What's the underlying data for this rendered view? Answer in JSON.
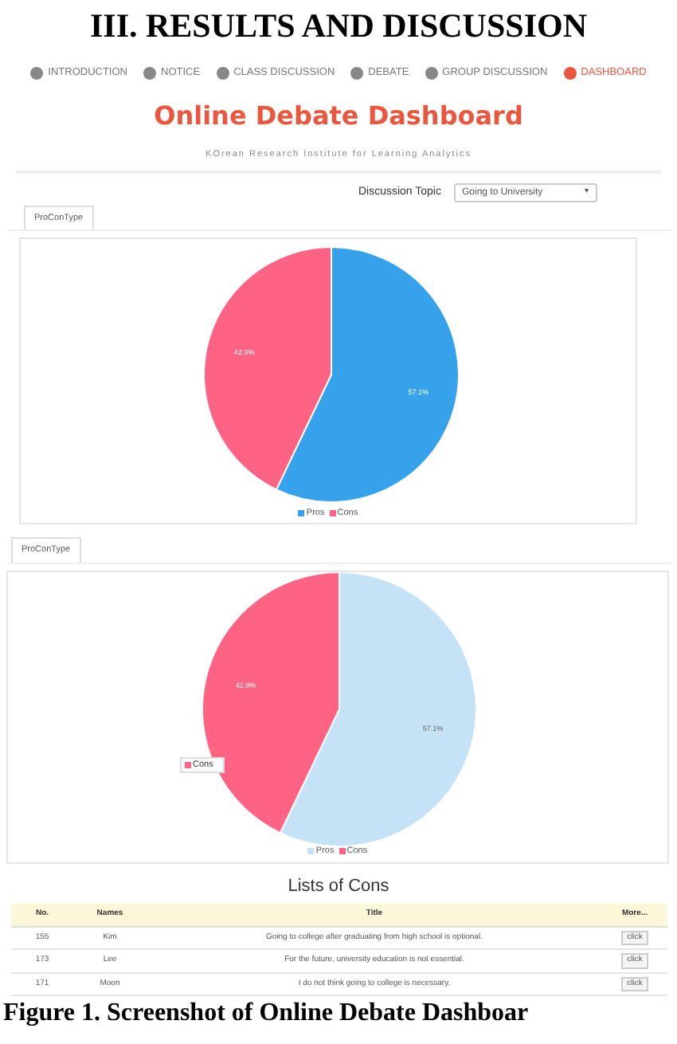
{
  "heading": "III. RESULTS AND DISCUSSION",
  "nav": [
    {
      "label": "INTRODUCTION",
      "selected": false
    },
    {
      "label": "NOTICE",
      "selected": false
    },
    {
      "label": "CLASS DISCUSSION",
      "selected": false
    },
    {
      "label": "DEBATE",
      "selected": false
    },
    {
      "label": "GROUP DISCUSSION",
      "selected": false
    },
    {
      "label": "DASHBOARD",
      "selected": true
    }
  ],
  "title": "Online Debate Dashboard",
  "subtitle": "KOrean Research Institute for Learning Analytics",
  "topic": {
    "label": "Discussion Topic",
    "value": "Going to University",
    "caret": "▾"
  },
  "charts": [
    {
      "chart_data": {
        "type": "pie",
        "legend": "bottom",
        "categories": [
          "Pros",
          "Cons"
        ],
        "series": [
          {
            "name": "ProConType",
            "values": [
              57.1,
              42.9
            ]
          }
        ],
        "colors": [
          "#36a2eb",
          "#ff6384"
        ],
        "value_labels": [
          "57.1%",
          "42.9%"
        ]
      }
    },
    {
      "tooltip": "Cons",
      "chart_data": {
        "type": "pie",
        "legend": "bottom",
        "categories": [
          "Pros",
          "Cons"
        ],
        "series": [
          {
            "name": "ProConType",
            "values": [
              57.1,
              42.9
            ]
          }
        ],
        "colors": [
          "#c6e2f7",
          "#ff6384"
        ],
        "value_labels": [
          "57.1%",
          "42.9%"
        ]
      }
    }
  ],
  "table": {
    "title": "Lists of Cons",
    "columns": [
      "No.",
      "Names",
      "Title",
      "More..."
    ],
    "rows": [
      {
        "no": "155",
        "name": "Kim",
        "title": "Going to college after graduating from high school is optional.",
        "action": "click"
      },
      {
        "no": "173",
        "name": "Lee",
        "title": "For the future, university education is not essential.",
        "action": "click"
      },
      {
        "no": "171",
        "name": "Moon",
        "title": "I do not think going to college is necessary.",
        "action": "click"
      }
    ]
  },
  "caption": "Figure 1. Screenshot of Online Debate Dashboar"
}
